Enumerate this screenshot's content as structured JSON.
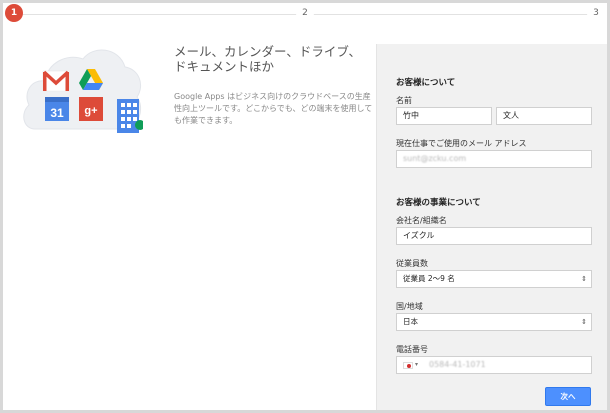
{
  "steps": [
    {
      "number": "1",
      "active": true
    },
    {
      "number": "2",
      "active": false
    },
    {
      "number": "3",
      "active": false
    }
  ],
  "intro": {
    "headline": "メール、カレンダー、ドライブ、ドキュメントほか",
    "description": "Google Apps はビジネス向けのクラウドベースの生産性向上ツールです。どこからでも、どの端末を使用しても作業できます。",
    "calendar_icon_text": "31",
    "gplus_icon_text": "g+"
  },
  "form": {
    "about_you_title": "お客様について",
    "name_label": "名前",
    "last_name_value": "竹中",
    "first_name_value": "文人",
    "email_label": "現在仕事でご使用のメール アドレス",
    "email_value": "sunt@zcku.com",
    "business_title": "お客様の事業について",
    "company_label": "会社名/組織名",
    "company_value": "イズクル",
    "employees_label": "従業員数",
    "employees_value": "従業員 2〜9 名",
    "country_label": "国/地域",
    "country_value": "日本",
    "phone_label": "電話番号",
    "phone_value": "0584-41-1071",
    "next_button": "次へ"
  },
  "colors": {
    "step_active": "#dd4b39",
    "button_blue": "#4d90fe",
    "panel_bg": "#f1f1f1"
  },
  "icons": [
    "gmail-icon",
    "drive-icon",
    "calendar-icon",
    "google-plus-icon",
    "building-icon",
    "flag-japan-icon",
    "select-arrows-icon"
  ]
}
